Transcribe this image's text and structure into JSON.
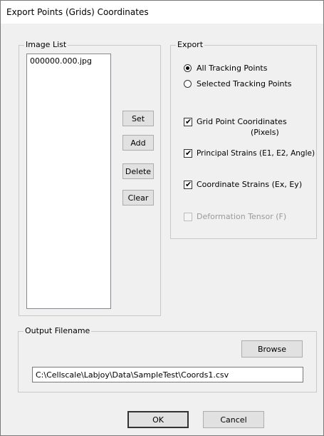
{
  "window": {
    "title": "Export Points (Grids) Coordinates"
  },
  "image_list": {
    "label": "Image List",
    "items": [
      "000000.000.jpg"
    ],
    "buttons": {
      "set": "Set",
      "add": "Add",
      "delete": "Delete",
      "clear": "Clear"
    }
  },
  "export": {
    "label": "Export",
    "radios": [
      {
        "label": "All Tracking Points",
        "selected": true
      },
      {
        "label": "Selected Tracking Points",
        "selected": false
      }
    ],
    "checkboxes": [
      {
        "label": "Grid Point Cooridinates",
        "sublabel": "(Pixels)",
        "checked": true,
        "enabled": true
      },
      {
        "label": "Principal Strains (E1, E2, Angle)",
        "checked": true,
        "enabled": true
      },
      {
        "label": "Coordinate Strains (Ex, Ey)",
        "checked": true,
        "enabled": true
      },
      {
        "label": "Deformation Tensor (F)",
        "checked": false,
        "enabled": false
      }
    ]
  },
  "output": {
    "label": "Output Filename",
    "browse": "Browse",
    "filename": "C:\\Cellscale\\Labjoy\\Data\\SampleTest\\Coords1.csv"
  },
  "footer": {
    "ok": "OK",
    "cancel": "Cancel"
  }
}
